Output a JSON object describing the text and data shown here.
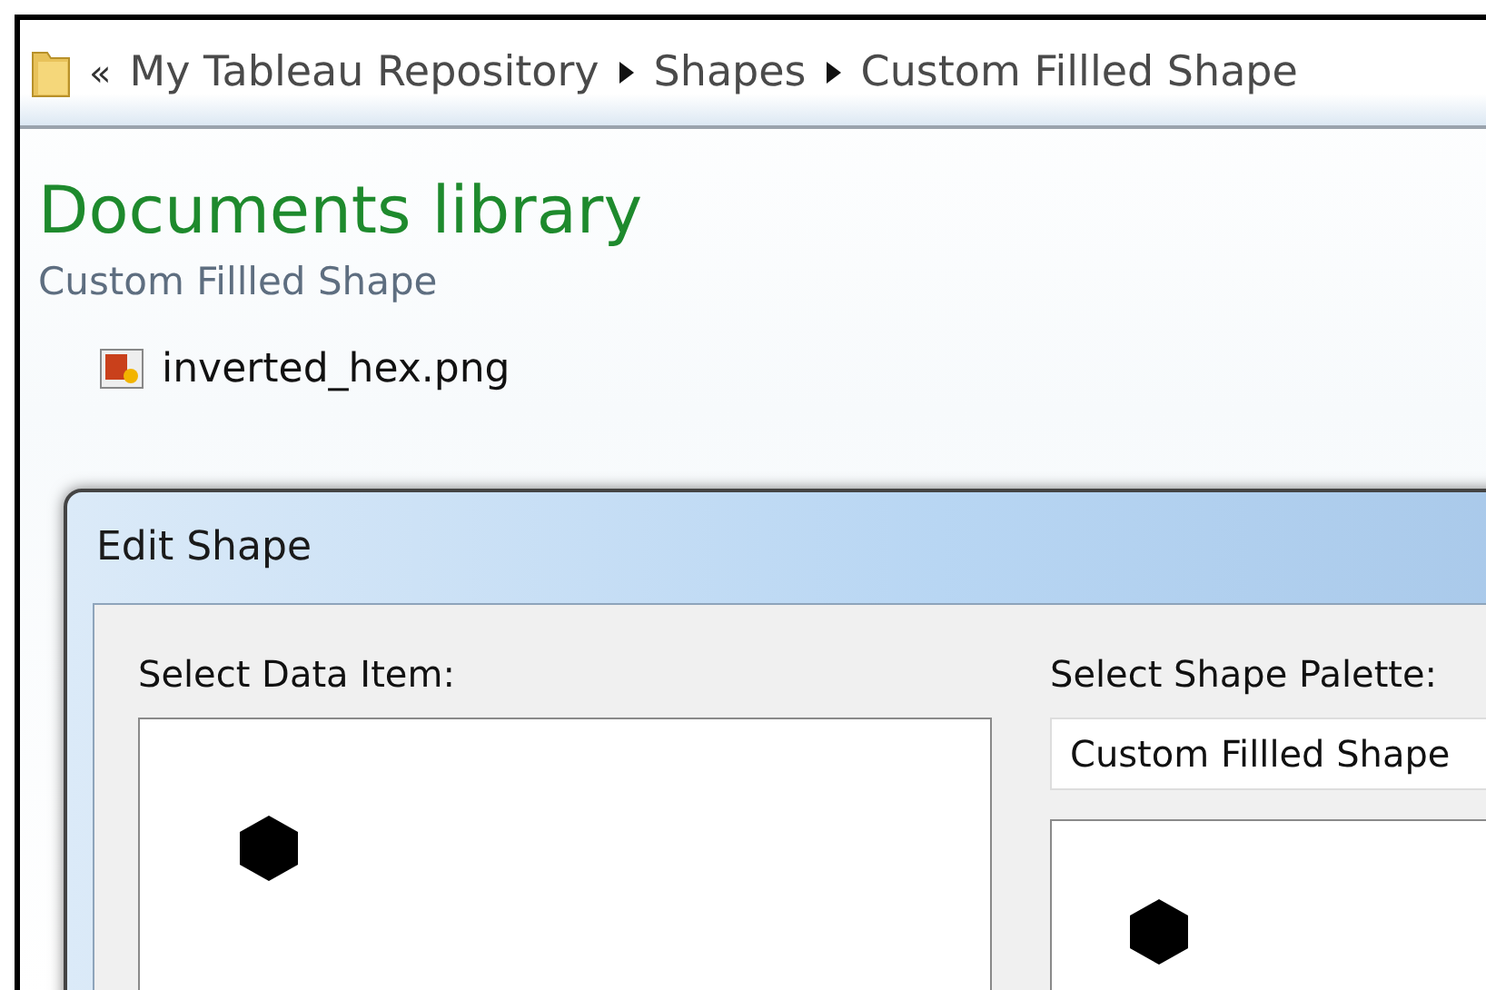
{
  "address_bar": {
    "overflow": "«",
    "crumbs": [
      "My Tableau Repository",
      "Shapes",
      "Custom Fillled Shape"
    ]
  },
  "library": {
    "title": "Documents library",
    "subtitle": "Custom Fillled Shape",
    "files": [
      "inverted_hex.png"
    ]
  },
  "dialog": {
    "title": "Edit Shape",
    "data_item_label": "Select Data Item:",
    "palette_label": "Select Shape Palette:",
    "palette_value": "Custom Fillled Shape"
  }
}
